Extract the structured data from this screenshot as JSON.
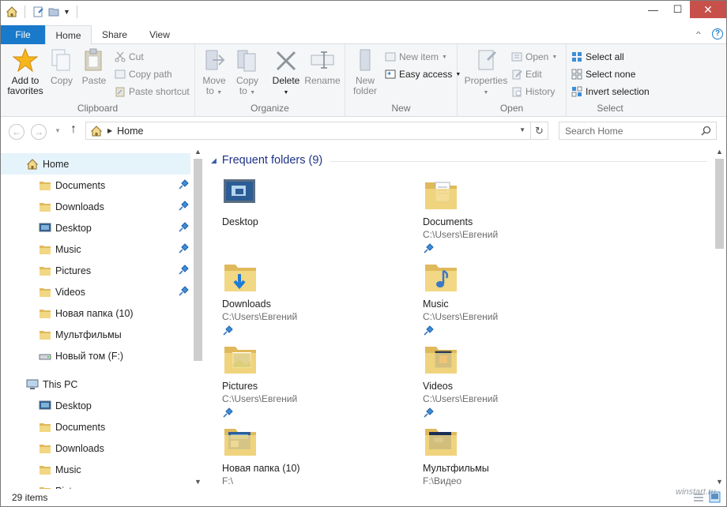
{
  "titlebar": {
    "minimize": "—",
    "maximize": "☐",
    "close": "✕"
  },
  "tabs": {
    "file": "File",
    "home": "Home",
    "share": "Share",
    "view": "View",
    "collapse": "^",
    "help": "?"
  },
  "ribbon": {
    "clipboard": {
      "label": "Clipboard",
      "add_to_favorites": [
        "Add to",
        "favorites"
      ],
      "copy": "Copy",
      "paste": "Paste",
      "cut": "Cut",
      "copy_path": "Copy path",
      "paste_shortcut": "Paste shortcut"
    },
    "organize": {
      "label": "Organize",
      "move_to": [
        "Move",
        "to"
      ],
      "copy_to": [
        "Copy",
        "to"
      ],
      "delete": "Delete",
      "rename": "Rename"
    },
    "new": {
      "label": "New",
      "new_folder": [
        "New",
        "folder"
      ],
      "new_item": "New item",
      "easy_access": "Easy access"
    },
    "open": {
      "label": "Open",
      "properties": "Properties",
      "open": "Open",
      "edit": "Edit",
      "history": "History"
    },
    "select": {
      "label": "Select",
      "select_all": "Select all",
      "select_none": "Select none",
      "invert_selection": "Invert selection"
    }
  },
  "address": {
    "path": "Home",
    "search_placeholder": "Search Home"
  },
  "nav": {
    "home": "Home",
    "quick": [
      {
        "label": "Documents",
        "pinned": true
      },
      {
        "label": "Downloads",
        "pinned": true
      },
      {
        "label": "Desktop",
        "pinned": true
      },
      {
        "label": "Music",
        "pinned": true
      },
      {
        "label": "Pictures",
        "pinned": true
      },
      {
        "label": "Videos",
        "pinned": true
      },
      {
        "label": "Новая папка (10)",
        "pinned": false
      },
      {
        "label": "Мультфильмы",
        "pinned": false
      },
      {
        "label": "Новый том (F:)",
        "pinned": false
      }
    ],
    "this_pc": "This PC",
    "pc_items": [
      "Desktop",
      "Documents",
      "Downloads",
      "Music",
      "Pictures"
    ]
  },
  "content": {
    "group_title": "Frequent folders (9)",
    "tiles": [
      {
        "name": "Desktop",
        "path": "",
        "icon": "desktop-icon",
        "pinned": false
      },
      {
        "name": "Documents",
        "path": "C:\\Users\\Евгений",
        "icon": "documents-folder-icon",
        "pinned": true
      },
      {
        "name": "Downloads",
        "path": "C:\\Users\\Евгений",
        "icon": "downloads-folder-icon",
        "pinned": true
      },
      {
        "name": "Music",
        "path": "C:\\Users\\Евгений",
        "icon": "music-folder-icon",
        "pinned": true
      },
      {
        "name": "Pictures",
        "path": "C:\\Users\\Евгений",
        "icon": "pictures-folder-icon",
        "pinned": true
      },
      {
        "name": "Videos",
        "path": "C:\\Users\\Евгений",
        "icon": "videos-folder-icon",
        "pinned": true
      },
      {
        "name": "Новая папка (10)",
        "path": "F:\\",
        "icon": "folder-icon",
        "pinned": false
      },
      {
        "name": "Мультфильмы",
        "path": "F:\\Видео",
        "icon": "folder-icon",
        "pinned": false
      }
    ]
  },
  "status": {
    "items": "29 items",
    "watermark": "winstart.ru"
  },
  "colors": {
    "accent": "#1979ca",
    "close": "#c7504b",
    "folder": "#f2d784",
    "group_title": "#1e3287",
    "selection": "#e5f3fb"
  }
}
